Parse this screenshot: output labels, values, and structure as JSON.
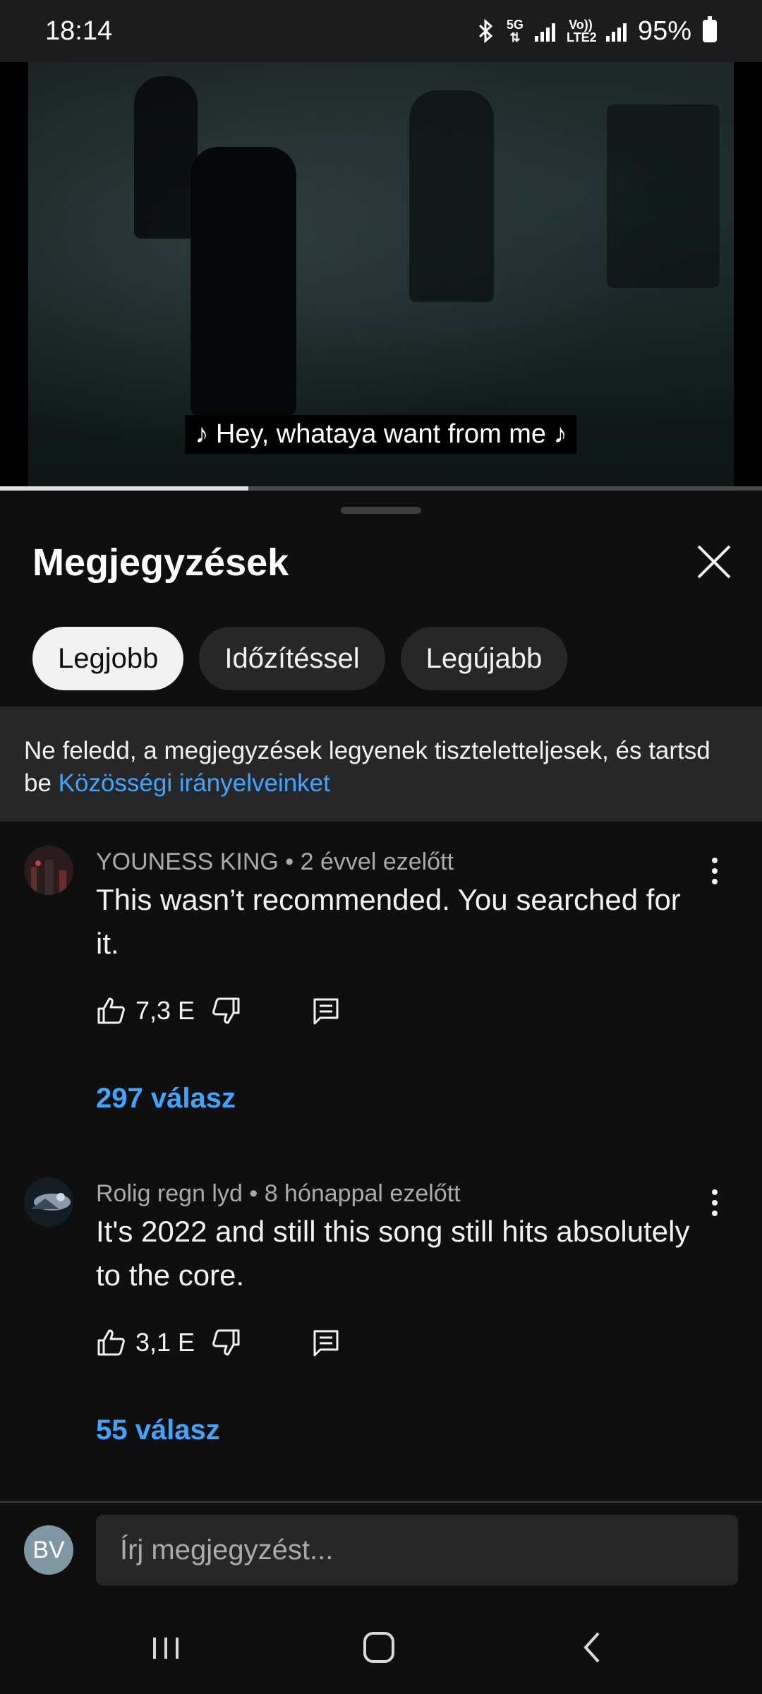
{
  "status_bar": {
    "time": "18:14",
    "network": "5G",
    "volte": "Vo)) LTE2",
    "battery_percent": "95%",
    "icons": [
      "bluetooth-icon",
      "5g-icon",
      "signal-icon",
      "volte-icon",
      "signal-icon",
      "battery-icon"
    ]
  },
  "video": {
    "caption": "♪ Hey, whataya want from me ♪",
    "progress": 0.326
  },
  "comments_panel": {
    "title": "Megjegyzések",
    "close_icon": "close-icon",
    "filters": [
      {
        "label": "Legjobb",
        "selected": true
      },
      {
        "label": "Időzítéssel",
        "selected": false
      },
      {
        "label": "Legújabb",
        "selected": false
      }
    ],
    "notice": {
      "text": "Ne feledd, a megjegyzések legyenek tiszteletteljesek, és tartsd be ",
      "link": "Közösségi irányelveinket"
    },
    "comments": [
      {
        "author": "YOUNESS KING",
        "time": "2 évvel ezelőtt",
        "text": "This wasn’t recommended. You searched for it.",
        "likes": "7,3 E",
        "replies": "297 válasz"
      },
      {
        "author": "Rolig regn lyd",
        "time": "8 hónappal ezelőtt",
        "text": "It's 2022 and still this song still hits absolutely to the core.",
        "likes": "3,1 E",
        "replies": "55 válasz"
      }
    ],
    "composer": {
      "avatar_initials": "BV",
      "placeholder": "Írj megjegyzést..."
    }
  },
  "colors": {
    "background": "#0f0f0f",
    "surface": "#272727",
    "link": "#3ea6ff",
    "secondary_text": "#aaaaaa"
  }
}
